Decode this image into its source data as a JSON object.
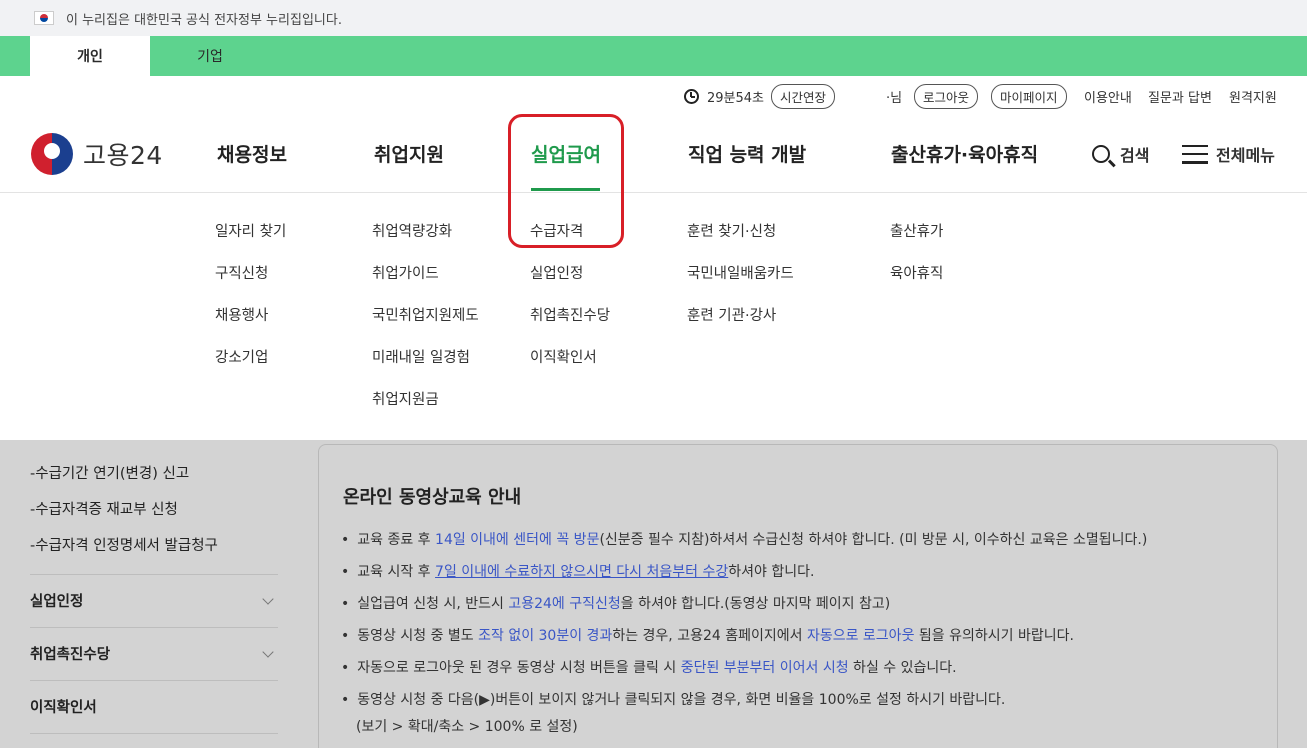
{
  "gov_notice": "이 누리집은 대한민국 공식 전자정부 누리집입니다.",
  "tabs": [
    {
      "label": "개인"
    },
    {
      "label": "기업"
    }
  ],
  "util": {
    "timer": "29분54초",
    "extend": "시간연장",
    "user_suffix": "·님",
    "logout": "로그아웃",
    "mypage": "마이페이지",
    "links": [
      "이용안내",
      "질문과 답변",
      "원격지원"
    ]
  },
  "logo": {
    "text": "고용24"
  },
  "gnb": [
    {
      "label": "채용정보"
    },
    {
      "label": "취업지원"
    },
    {
      "label": "실업급여"
    },
    {
      "label": "직업 능력 개발"
    },
    {
      "label": "출산휴가·육아휴직"
    }
  ],
  "header_actions": {
    "search": "검색",
    "menu": "전체메뉴"
  },
  "submenu": {
    "jobs": [
      "일자리 찾기",
      "구직신청",
      "채용행사",
      "강소기업"
    ],
    "support": [
      "취업역량강화",
      "취업가이드",
      "국민취업지원제도",
      "미래내일 일경험",
      "취업지원금"
    ],
    "benefit": [
      "수급자격",
      "실업인정",
      "취업촉진수당",
      "이직확인서"
    ],
    "training": [
      "훈련 찾기·신청",
      "국민내일배움카드",
      "훈련 기관·강사"
    ],
    "leave": [
      "출산휴가",
      "육아휴직"
    ]
  },
  "sidebar": {
    "sub_items": [
      "-수급기간 연기(변경) 신고",
      "-수급자격증 재교부 신청",
      "-수급자격 인정명세서 발급청구"
    ],
    "sections": [
      "실업인정",
      "취업촉진수당",
      "이직확인서"
    ]
  },
  "panel": {
    "title": "온라인 동영상교육 안내",
    "b1": {
      "pre": "교육 종료 후 ",
      "link": "14일 이내에 센터에 꼭 방문",
      "post": "(신분증 필수 지참)하셔서 수급신청 하셔야 합니다. (미 방문 시, 이수하신 교육은 소멸됩니다.)"
    },
    "b2": {
      "pre": "교육 시작 후 ",
      "link": "7일 이내에 수료하지 않으시면 다시 처음부터 수강",
      "post": "하셔야 합니다."
    },
    "b3": {
      "pre": "실업급여 신청 시, 반드시 ",
      "link": "고용24에 구직신청",
      "post": "을 하셔야 합니다.(동영상 마지막 페이지 참고)"
    },
    "b4": {
      "pre": "동영상 시청 중 별도 ",
      "link1": "조작 없이 30분이 경과",
      "mid": "하는 경우, 고용24 홈페이지에서 ",
      "link2": "자동으로 로그아웃",
      "post": " 됨을 유의하시기 바랍니다."
    },
    "b5": {
      "pre": "자동으로 로그아웃 된 경우 동영상 시청 버튼을 클릭 시 ",
      "link": "중단된 부분부터 이어서 시청",
      "post": " 하실 수 있습니다."
    },
    "b6": {
      "line1": "동영상 시청 중 다음(▶)버튼이 보이지 않거나 클릭되지 않을 경우, 화면 비율을 100%로 설정 하시기 바랍니다.",
      "line2": "(보기 > 확대/축소 > 100% 로 설정)"
    }
  }
}
